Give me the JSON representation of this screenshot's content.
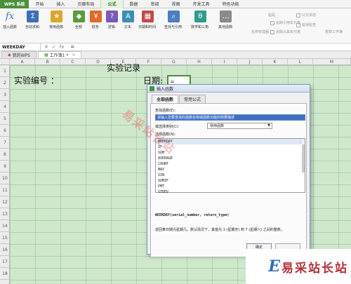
{
  "app": {
    "menu_button": "WPS 系统"
  },
  "menu_tabs": [
    "开始",
    "插入",
    "页面布局",
    "公式",
    "数据",
    "审阅",
    "视图",
    "开发工具",
    "特色功能"
  ],
  "ribbon": {
    "buttons": [
      {
        "label": "插入函数",
        "icon": "fx-icon"
      },
      {
        "label": "自动求和·",
        "icon": "sum-icon"
      },
      {
        "label": "常用函数·",
        "icon": "star-icon"
      },
      {
        "label": "全部·",
        "icon": "all-functions-icon"
      },
      {
        "label": "财务·",
        "icon": "finance-icon"
      },
      {
        "label": "逻辑·",
        "icon": "logic-icon"
      },
      {
        "label": "文本·",
        "icon": "text-icon"
      },
      {
        "label": "日期和时间·",
        "icon": "calendar-icon"
      },
      {
        "label": "查找与引用·",
        "icon": "lookup-icon"
      },
      {
        "label": "数学和三角·",
        "icon": "math-icon"
      },
      {
        "label": "其他函数·",
        "icon": "more-icon"
      }
    ],
    "name_manager": "名称管理器",
    "paste": "粘贴",
    "trace_precedents": "追踪引用单元格",
    "trace_dependents": "追踪从属单元格",
    "show_formulas": "公式求值",
    "error_check": "错误检查·",
    "recalc": "重算工作簿"
  },
  "formula_bar": {
    "name_box": "WEEKDAY",
    "input": "="
  },
  "doc_tabs": [
    {
      "label": "我的WPS"
    },
    {
      "label": "工作簿1 *"
    }
  ],
  "sheet": {
    "columns": [
      "A",
      "B",
      "C",
      "D",
      "E",
      "F",
      "G",
      "H",
      "I",
      "J",
      "K",
      "L",
      "M"
    ],
    "rows": [
      "1",
      "2",
      "3",
      "4",
      "5",
      "6",
      "7",
      "8",
      "9",
      "10",
      "11",
      "12",
      "13",
      "14",
      "15",
      "16",
      "17",
      "18"
    ],
    "title": "实验记录",
    "label_id": "实验编号 ：",
    "label_date": "日期:",
    "active_cell_value": "="
  },
  "dialog": {
    "title": "插入函数",
    "tabs": [
      "全部函数",
      "常用公式"
    ],
    "search_label": "查找函数(E)：",
    "search_value": "请输入您要查找的函数名称或函数功能的简要描述",
    "category_label": "或选择类别(C)：",
    "category_value": "常用函数",
    "list_label": "选择函数(N)：",
    "functions": [
      "WEEKDAY",
      "IF",
      "SUM",
      "AVERAGE",
      "COUNT",
      "MAX",
      "SIN",
      "SUMIF",
      "PMT",
      "STDEV",
      "HYPERLINK",
      "EDATE",
      "DAY",
      "DATEVALUE"
    ],
    "selected_function": "WEEKDAY",
    "syntax": "WEEKDAY(serial_number, return_type)",
    "description": "返回某日期为星期几。默认情况下，其值为 1 (星期天) 到 7 (星期六) 之间的整数。",
    "ok": "确定",
    "cancel": "取消"
  },
  "watermark": "易采站长站",
  "logo": {
    "letter": "E",
    "text": "易采站长站"
  }
}
